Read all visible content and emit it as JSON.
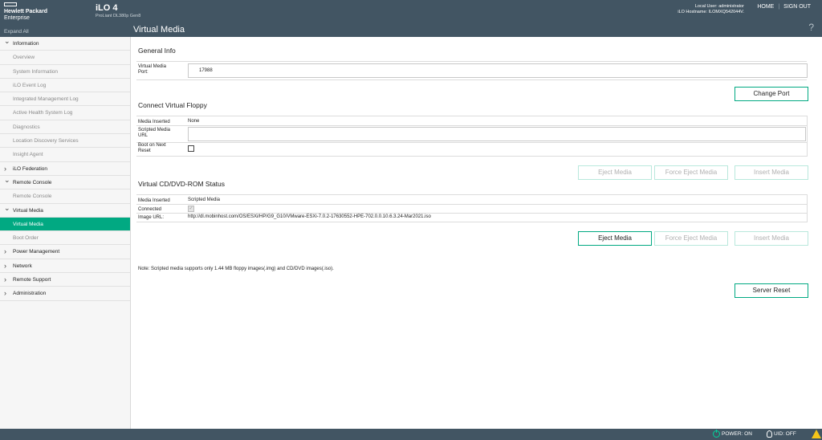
{
  "header": {
    "brand_line1": "Hewlett Packard",
    "brand_line2": "Enterprise",
    "product": "iLO 4",
    "server_model": "ProLiant DL380p Gen8",
    "local_user": "Local User: administrator",
    "hostname": "iLO Hostname: ILOMXQ542044V.",
    "home": "HOME",
    "sign_out": "SIGN OUT",
    "separator": "|"
  },
  "subbar": {
    "expand_all": "Expand All",
    "page_title": "Virtual Media",
    "help": "?"
  },
  "sidebar": {
    "items": [
      {
        "label": "Information",
        "type": "section",
        "chevron": "v"
      },
      {
        "label": "Overview",
        "type": "child"
      },
      {
        "label": "System Information",
        "type": "child"
      },
      {
        "label": "iLO Event Log",
        "type": "child"
      },
      {
        "label": "Integrated Management Log",
        "type": "child"
      },
      {
        "label": "Active Health System Log",
        "type": "child"
      },
      {
        "label": "Diagnostics",
        "type": "child"
      },
      {
        "label": "Location Discovery Services",
        "type": "child"
      },
      {
        "label": "Insight Agent",
        "type": "child"
      },
      {
        "label": "iLO Federation",
        "type": "section",
        "chevron": ">"
      },
      {
        "label": "Remote Console",
        "type": "section",
        "chevron": "v"
      },
      {
        "label": "Remote Console",
        "type": "child"
      },
      {
        "label": "Virtual Media",
        "type": "section",
        "chevron": "v"
      },
      {
        "label": "Virtual Media",
        "type": "child",
        "active": true
      },
      {
        "label": "Boot Order",
        "type": "child"
      },
      {
        "label": "Power Management",
        "type": "section",
        "chevron": ">"
      },
      {
        "label": "Network",
        "type": "section",
        "chevron": ">"
      },
      {
        "label": "Remote Support",
        "type": "section",
        "chevron": ">"
      },
      {
        "label": "Administration",
        "type": "section",
        "chevron": ">"
      }
    ]
  },
  "general_info": {
    "title": "General Info",
    "port_label_1": "Virtual Media",
    "port_label_2": "Port:",
    "port_value": "17988",
    "change_port": "Change Port"
  },
  "floppy": {
    "title": "Connect Virtual Floppy",
    "media_inserted_label": "Media Inserted",
    "media_inserted_value": "None",
    "scripted_url_label_1": "Scripted Media",
    "scripted_url_label_2": "URL",
    "scripted_url_value": "",
    "boot_label_1": "Boot on Next",
    "boot_label_2": "Reset",
    "eject": "Eject Media",
    "force_eject": "Force Eject Media",
    "insert": "Insert Media"
  },
  "cdrom": {
    "title": "Virtual CD/DVD-ROM Status",
    "media_inserted_label": "Media Inserted",
    "media_inserted_value": "Scripted Media",
    "connected_label": "Connected",
    "image_url_label": "Image URL:",
    "image_url_value": "http://dl.mobinhost.com/OS/ESXi/HP/G9_G10/VMware-ESXi-7.0.2-17630552-HPE-702.0.0.10.6.3.24-Mar2021.iso",
    "eject": "Eject Media",
    "force_eject": "Force Eject Media",
    "insert": "Insert Media"
  },
  "note": "Note: Scripted media supports only 1.44 MB floppy images(.img) and CD/DVD images(.iso).",
  "server_reset": "Server Reset",
  "footer": {
    "power": "POWER: ON",
    "uid": "UID: OFF"
  },
  "colors": {
    "header": "#425563",
    "accent": "#01a982",
    "warning": "#f5c518"
  }
}
